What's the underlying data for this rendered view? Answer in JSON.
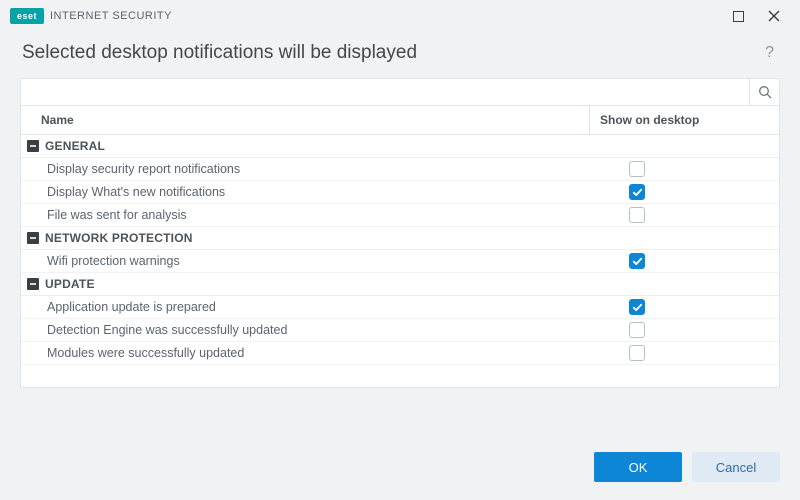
{
  "brand": {
    "logo_text": "eset",
    "product": "INTERNET SECURITY"
  },
  "subtitle": "Selected desktop notifications will be displayed",
  "search": {
    "placeholder": ""
  },
  "columns": {
    "name": "Name",
    "show": "Show on desktop"
  },
  "groups": [
    {
      "label": "GENERAL",
      "items": [
        {
          "name": "Display security report notifications",
          "checked": false
        },
        {
          "name": "Display What's new notifications",
          "checked": true
        },
        {
          "name": "File was sent for analysis",
          "checked": false
        }
      ]
    },
    {
      "label": "NETWORK PROTECTION",
      "items": [
        {
          "name": "Wifi protection warnings",
          "checked": true
        }
      ]
    },
    {
      "label": "UPDATE",
      "items": [
        {
          "name": "Application update is prepared",
          "checked": true
        },
        {
          "name": "Detection Engine was successfully updated",
          "checked": false
        },
        {
          "name": "Modules were successfully updated",
          "checked": false
        }
      ]
    }
  ],
  "buttons": {
    "ok": "OK",
    "cancel": "Cancel"
  }
}
